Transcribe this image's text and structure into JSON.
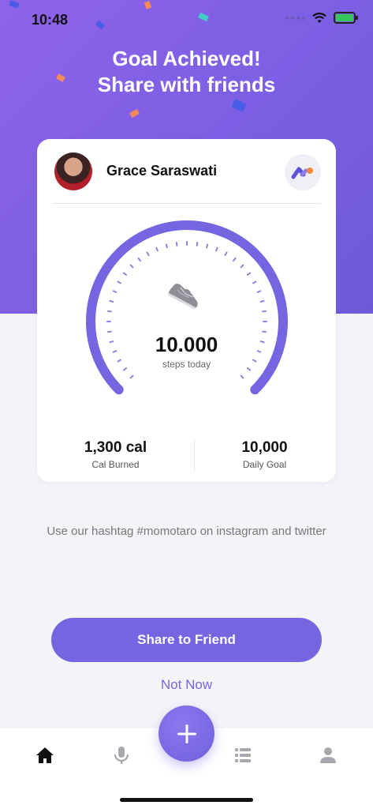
{
  "status_bar": {
    "time": "10:48"
  },
  "hero": {
    "title_line1": "Goal Achieved!",
    "title_line2": "Share with friends"
  },
  "card": {
    "user_name": "Grace Saraswati",
    "steps_value": "10.000",
    "steps_label": "steps today",
    "stats": [
      {
        "value": "1,300 cal",
        "label": "Cal Burned"
      },
      {
        "value": "10,000",
        "label": "Daily Goal"
      }
    ],
    "gauge_progress": 1.0
  },
  "hashtag_text": "Use our hashtag #momotaro on instagram and twitter",
  "buttons": {
    "share_label": "Share to Friend",
    "not_now_label": "Not Now"
  },
  "tabbar": {
    "items": [
      "home-icon",
      "microphone-icon",
      "add-icon",
      "list-icon",
      "profile-icon"
    ],
    "active": "home-icon"
  },
  "colors": {
    "accent": "#7466e0",
    "gradient_start": "#8e63ea",
    "gradient_end": "#6e5ad8",
    "background": "#f4f4f8"
  }
}
